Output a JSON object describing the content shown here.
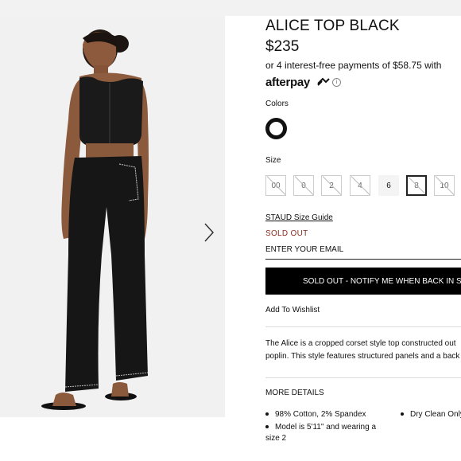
{
  "product": {
    "title": "ALICE TOP BLACK",
    "price": "$235",
    "installments": "or 4 interest-free payments of $58.75 with",
    "afterpay_logo": "afterpay",
    "colors_label": "Colors",
    "selected_color": "#111111",
    "size_label": "Size",
    "sizes": [
      {
        "label": "00",
        "state": "sold-out"
      },
      {
        "label": "0",
        "state": "sold-out"
      },
      {
        "label": "2",
        "state": "sold-out"
      },
      {
        "label": "4",
        "state": "sold-out"
      },
      {
        "label": "6",
        "state": "available"
      },
      {
        "label": "8",
        "state": "selected-sold-out"
      },
      {
        "label": "10",
        "state": "sold-out"
      }
    ],
    "size_guide": "STAUD Size Guide",
    "status": "SOLD OUT",
    "email_placeholder": "ENTER YOUR EMAIL",
    "notify_button": "SOLD OUT - NOTIFY ME WHEN BACK IN ST",
    "wishlist": "Add To Wishlist",
    "description_lines": [
      "The Alice is a cropped corset style top constructed out",
      "poplin. This style features structured panels and a back"
    ],
    "more_details": "MORE DETAILS",
    "details": {
      "fabric": "98% Cotton, 2% Spandex",
      "care": "Dry Clean Only",
      "model_line1": "Model is 5'11\" and wearing a",
      "model_line2": "size 2"
    }
  },
  "icons": {
    "carousel_next": "chevron-right-icon",
    "afterpay": "afterpay-arrows-icon",
    "info": "info-icon"
  },
  "colors": {
    "sold_out_text": "#8a2b1e",
    "button_bg": "#000000",
    "photo_bg": "#f1f1f1"
  }
}
